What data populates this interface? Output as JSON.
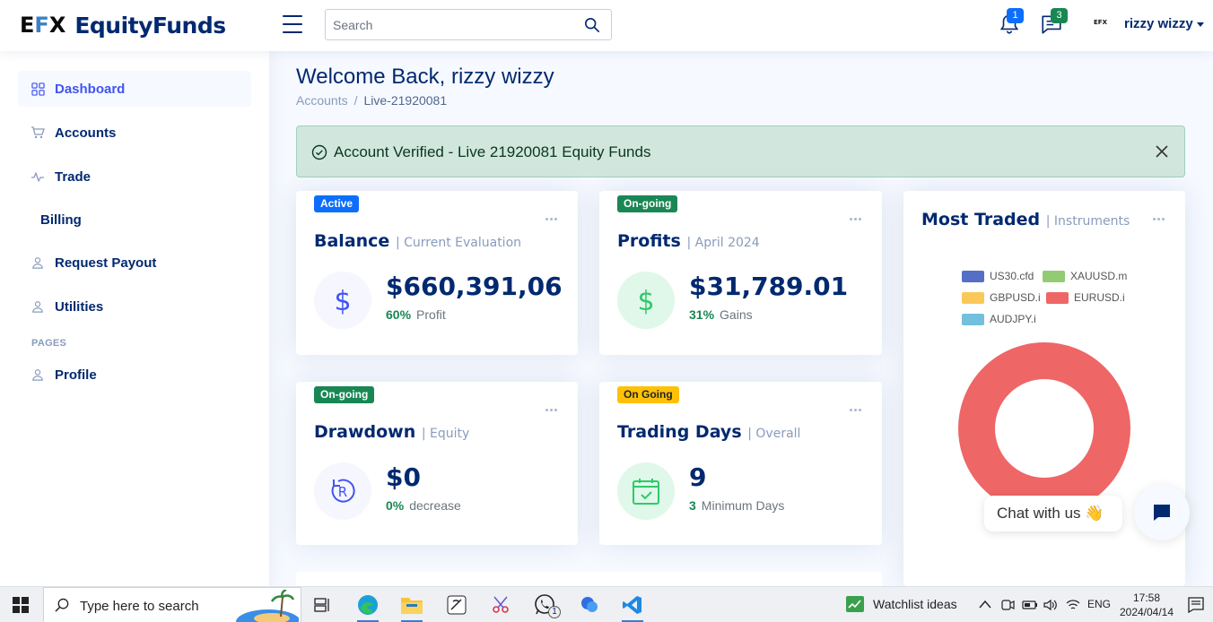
{
  "header": {
    "logo_mark": "EFX",
    "brand": "EquityFunds",
    "search_placeholder": "Search",
    "notifications_count": "1",
    "messages_count": "3",
    "small_logo": "EFX",
    "user_name": "rizzy wizzy"
  },
  "sidebar": {
    "items": [
      {
        "label": "Dashboard"
      },
      {
        "label": "Accounts"
      },
      {
        "label": "Trade"
      },
      {
        "label": "Billing"
      },
      {
        "label": "Request Payout"
      },
      {
        "label": "Utilities"
      },
      {
        "label": "Profile"
      }
    ],
    "pages_heading": "PAGES"
  },
  "main": {
    "title": "Welcome Back, rizzy wizzy",
    "breadcrumb": {
      "parent": "Accounts",
      "separator": "/",
      "current": "Live-21920081"
    },
    "alert": "Account Verified - Live 21920081 Equity Funds",
    "cards": {
      "balance": {
        "tag": "Active",
        "title": "Balance",
        "sub": "| Current Evaluation",
        "value": "$660,391,06",
        "pct": "60%",
        "label": "Profit"
      },
      "profits": {
        "tag": "On-going",
        "title": "Profits",
        "sub": "| April 2024",
        "value": "$31,789.01",
        "pct": "31%",
        "label": "Gains"
      },
      "drawdown": {
        "tag": "On-going",
        "title": "Drawdown",
        "sub": "| Equity",
        "value": "$0",
        "pct": "0%",
        "label": "decrease"
      },
      "trading_days": {
        "tag": "On Going",
        "title": "Trading Days",
        "sub": "| Overall",
        "value": "9",
        "pct": "3",
        "label": "Minimum Days"
      }
    },
    "most_traded": {
      "title": "Most Traded",
      "sub": "| Instruments"
    }
  },
  "chart_data": {
    "type": "pie",
    "categories": [
      "US30.cfd",
      "XAUUSD.m",
      "GBPUSD.i",
      "EURUSD.i",
      "AUDJPY.i"
    ],
    "values": [
      0,
      0,
      0,
      100,
      0
    ],
    "colors": [
      "#5470c6",
      "#91cc75",
      "#fac858",
      "#ee6666",
      "#73c0de"
    ],
    "donut": true,
    "legend_position": "top"
  },
  "chat": {
    "label": "Chat with us 👋"
  },
  "taskbar": {
    "search_placeholder": "Type here to search",
    "whatsapp_badge": "1",
    "watchlist": "Watchlist ideas",
    "lang": "ENG",
    "time": "17:58",
    "date": "2024/04/14"
  },
  "colors": {
    "primary": "#012970",
    "accent": "#4154f1",
    "success": "#198754",
    "alert_bg": "#d1e7dd"
  }
}
